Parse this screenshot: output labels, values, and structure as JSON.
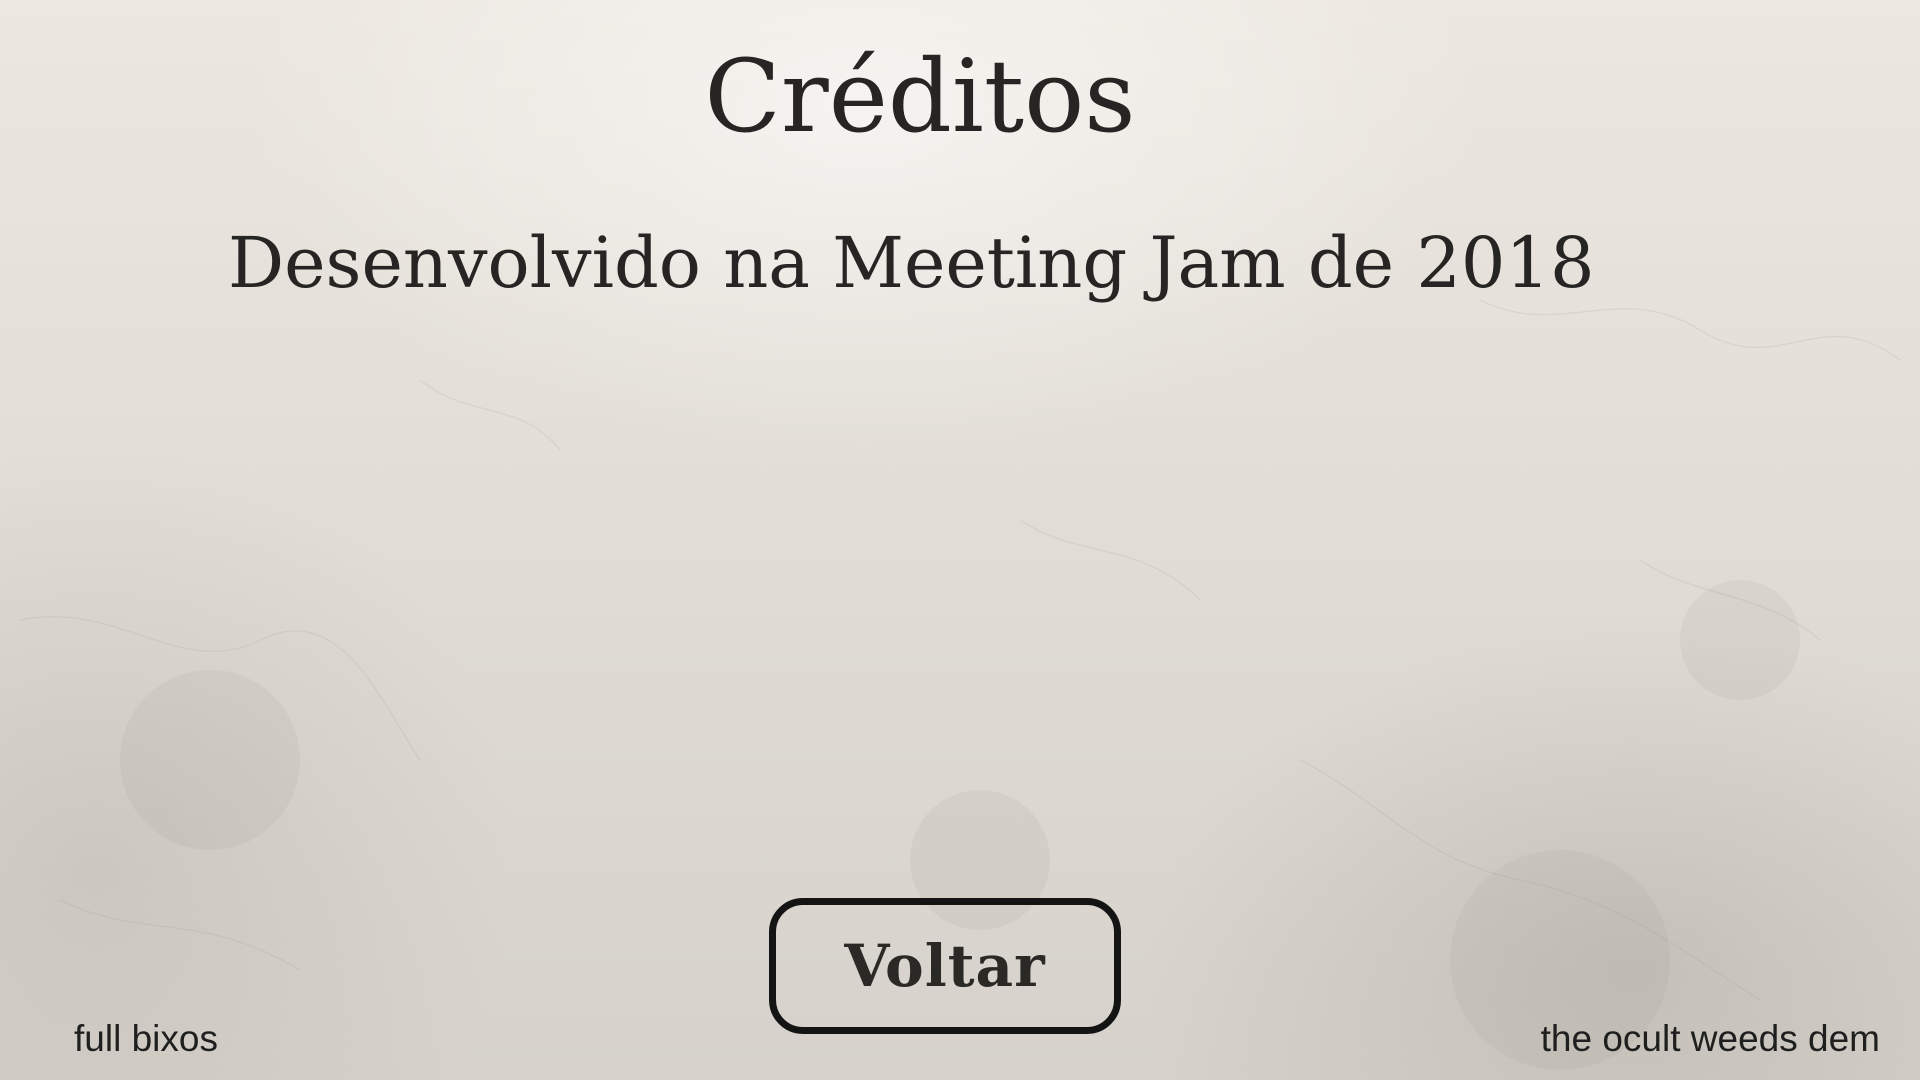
{
  "screen": {
    "title": "Créditos",
    "subtitle": "Desenvolvido na Meeting Jam de 2018"
  },
  "buttons": {
    "back_label": "Voltar"
  },
  "footer": {
    "left_credit": "full bixos",
    "right_credit": "the ocult weeds dem"
  },
  "colors": {
    "background": "#e4e0d9",
    "text": "#262523",
    "button_border": "#141414"
  }
}
